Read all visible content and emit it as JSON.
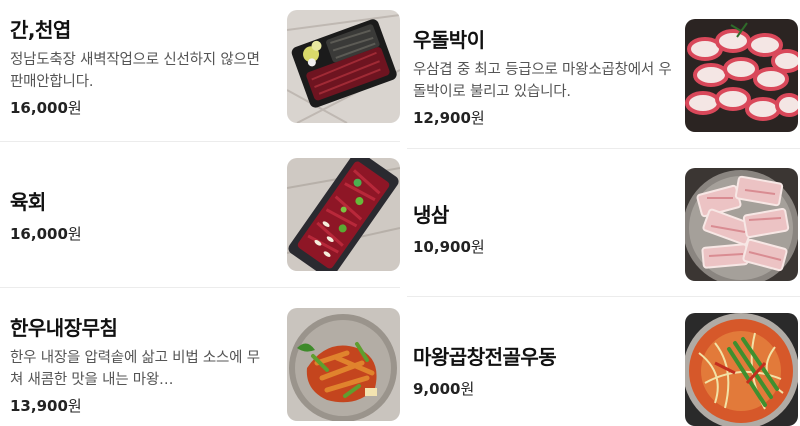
{
  "currency": "원",
  "left_column": [
    {
      "name": "간,천엽",
      "description": "정남도축장 새벽작업으로 신선하지 않으면 판매안합니다.",
      "price": "16,000",
      "image": "raw-liver-tripe-platter"
    },
    {
      "name": "육회",
      "description": "",
      "price": "16,000",
      "image": "beef-tartare-platter"
    },
    {
      "name": "한우내장무침",
      "description": "한우 내장을 압력솥에 삶고 비법 소스에 무쳐 새콤한 맛을 내는 마왕…",
      "price": "13,900",
      "image": "spicy-beef-offal-salad"
    }
  ],
  "right_column": [
    {
      "name": "우돌박이",
      "description": "우삼겹 중 최고 등급으로 마왕소곱창에서 우돌박이로 불리고 있습니다.",
      "price": "12,900",
      "image": "rolled-beef-brisket"
    },
    {
      "name": "냉삼",
      "description": "",
      "price": "10,900",
      "image": "frozen-pork-belly"
    },
    {
      "name": "마왕곱창전골우동",
      "description": "",
      "price": "9,000",
      "image": "gopchang-hotpot-udon"
    }
  ]
}
